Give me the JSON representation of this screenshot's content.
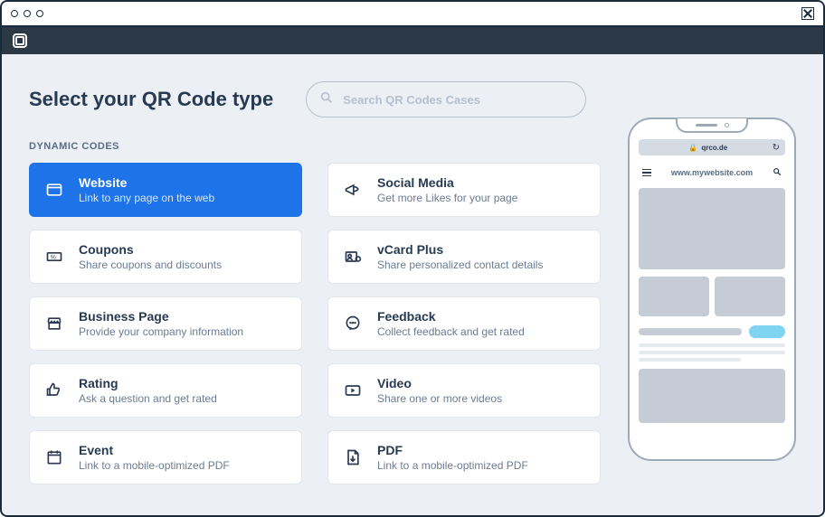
{
  "page": {
    "title": "Select your QR Code type",
    "section_label": "DYNAMIC CODES"
  },
  "search": {
    "placeholder": "Search QR Codes Cases"
  },
  "cards": {
    "website": {
      "title": "Website",
      "desc": "Link to any page on the web"
    },
    "social": {
      "title": "Social Media",
      "desc": "Get more Likes for your page"
    },
    "coupons": {
      "title": "Coupons",
      "desc": "Share coupons and discounts"
    },
    "vcard": {
      "title": "vCard Plus",
      "desc": "Share personalized contact details"
    },
    "business": {
      "title": "Business Page",
      "desc": "Provide your company information"
    },
    "feedback": {
      "title": "Feedback",
      "desc": "Collect feedback and get rated"
    },
    "rating": {
      "title": "Rating",
      "desc": "Ask a question and get rated"
    },
    "video": {
      "title": "Video",
      "desc": "Share one or more videos"
    },
    "event": {
      "title": "Event",
      "desc": "Link to a mobile-optimized PDF"
    },
    "pdf": {
      "title": "PDF",
      "desc": "Link to a mobile-optimized PDF"
    }
  },
  "phone": {
    "domain": "qrco.de",
    "site_url": "www.mywebsite.com"
  }
}
